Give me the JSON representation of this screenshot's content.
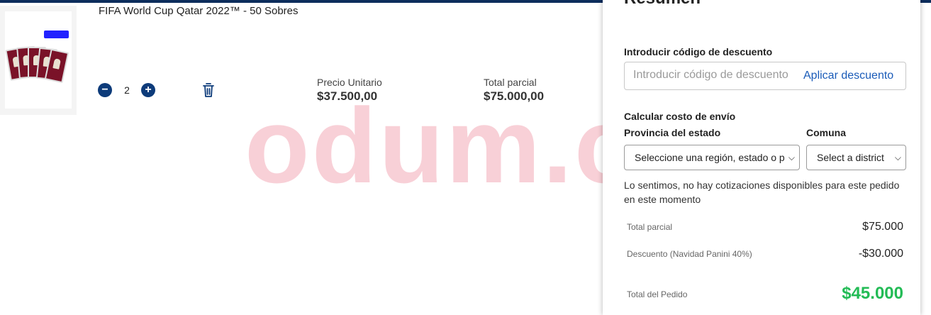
{
  "product": {
    "title": "FIFA World Cup Qatar 2022™ - 50 Sobres",
    "quantity": "2",
    "decrement_symbol": "−",
    "increment_symbol": "+",
    "unit_price_label": "Precio Unitario",
    "unit_price_value": "$37.500,00",
    "subtotal_label": "Total parcial",
    "subtotal_value": "$75.000,00",
    "remove_icon": "trash-icon"
  },
  "watermark": "odum.cl",
  "summary": {
    "title": "Resumen",
    "discount_label": "Introducir código de descuento",
    "discount_placeholder": "Introducir código de descuento",
    "apply_label": "Aplicar descuento",
    "shipping_label": "Calcular costo de envío",
    "province_label": "Provincia del estado",
    "province_select": "Seleccione una región, estado o p",
    "commune_label": "Comuna",
    "commune_select": "Select a district",
    "notice": "Lo sentimos, no hay cotizaciones disponibles para este pedido en este momento",
    "subtotal_label": "Total parcial",
    "subtotal_value": "$75.000",
    "discount_line_label": "Descuento (Navidad Panini 40%)",
    "discount_line_value": "-$30.000",
    "total_label": "Total del Pedido",
    "total_value": "$45.000"
  },
  "colors": {
    "header_bar": "#0d2d5c",
    "qty_button": "#0d3b7a",
    "link": "#1a5bb8",
    "total": "#22bb55"
  }
}
